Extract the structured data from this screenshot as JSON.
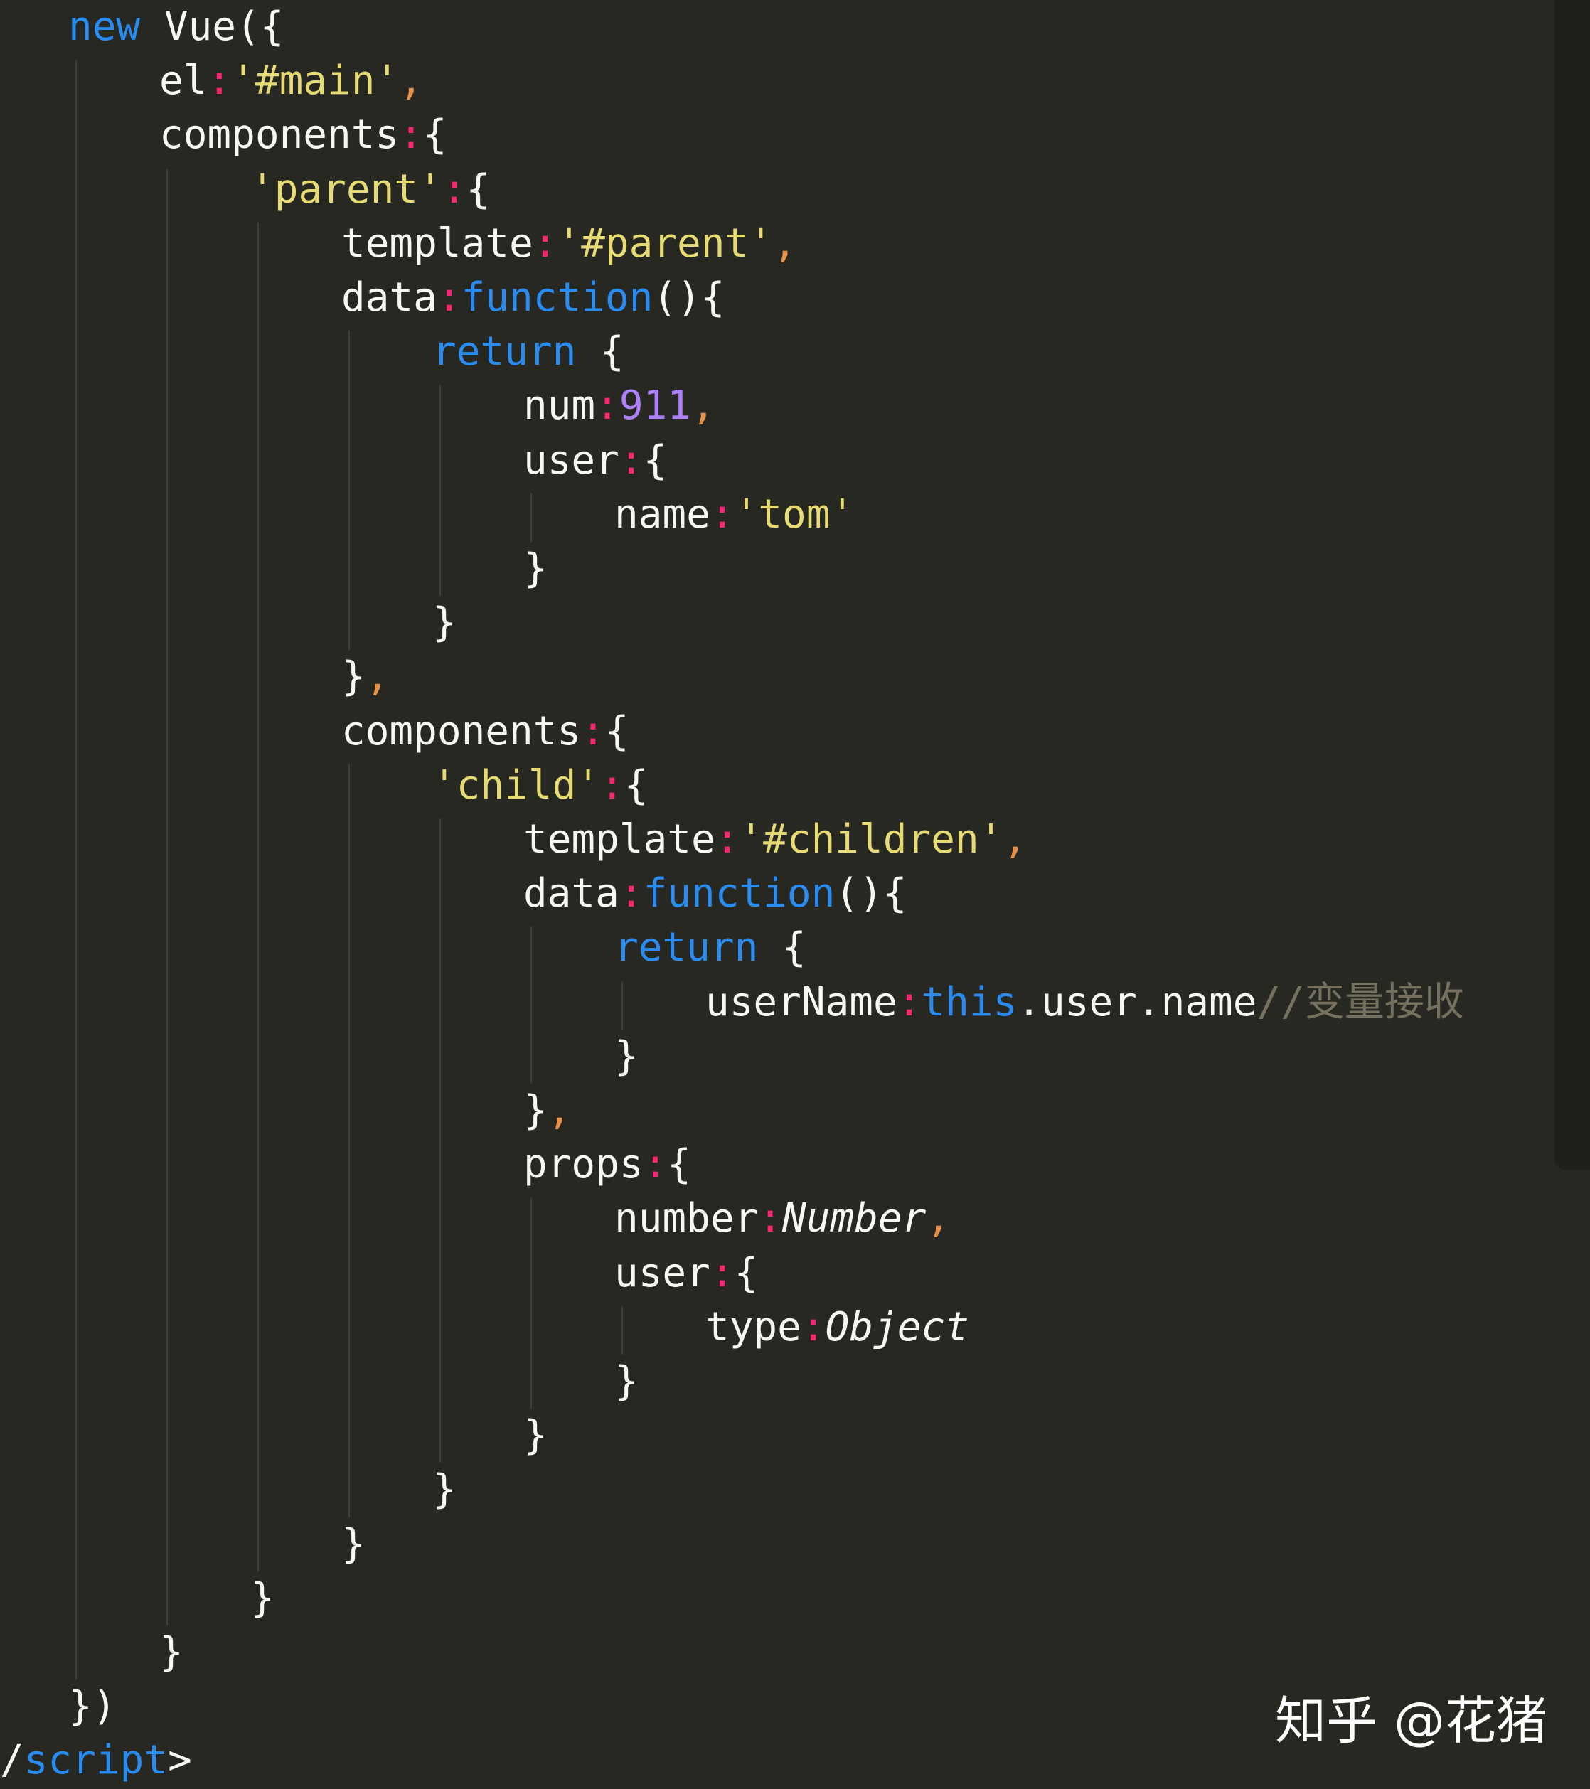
{
  "colors": {
    "background": "#272822",
    "keyword": "#2A8CF0",
    "string": "#E6DB74",
    "number": "#AE81FF",
    "colon": "#F92672",
    "comma": "#E6904A",
    "comment": "#75715E",
    "plain": "#F8F8F2"
  },
  "watermark": "知乎 @花猪",
  "code_lines": [
    {
      "indent": 1,
      "tokens": [
        {
          "t": "keyword",
          "v": "new"
        },
        {
          "t": "plain",
          "v": " Vue({"
        }
      ]
    },
    {
      "indent": 2,
      "tokens": [
        {
          "t": "plain",
          "v": "el"
        },
        {
          "t": "colon",
          "v": ":"
        },
        {
          "t": "string",
          "v": "'#main'"
        },
        {
          "t": "comma",
          "v": ","
        }
      ]
    },
    {
      "indent": 2,
      "tokens": [
        {
          "t": "plain",
          "v": "components"
        },
        {
          "t": "colon",
          "v": ":"
        },
        {
          "t": "plain",
          "v": "{"
        }
      ]
    },
    {
      "indent": 3,
      "tokens": [
        {
          "t": "string",
          "v": "'parent'"
        },
        {
          "t": "colon",
          "v": ":"
        },
        {
          "t": "plain",
          "v": "{"
        }
      ]
    },
    {
      "indent": 4,
      "tokens": [
        {
          "t": "plain",
          "v": "template"
        },
        {
          "t": "colon",
          "v": ":"
        },
        {
          "t": "string",
          "v": "'#parent'"
        },
        {
          "t": "comma",
          "v": ","
        }
      ]
    },
    {
      "indent": 4,
      "tokens": [
        {
          "t": "plain",
          "v": "data"
        },
        {
          "t": "colon",
          "v": ":"
        },
        {
          "t": "keyword",
          "v": "function"
        },
        {
          "t": "plain",
          "v": "(){"
        }
      ]
    },
    {
      "indent": 5,
      "tokens": [
        {
          "t": "keyword",
          "v": "return"
        },
        {
          "t": "plain",
          "v": " {"
        }
      ]
    },
    {
      "indent": 6,
      "tokens": [
        {
          "t": "plain",
          "v": "num"
        },
        {
          "t": "colon",
          "v": ":"
        },
        {
          "t": "number",
          "v": "911"
        },
        {
          "t": "comma",
          "v": ","
        }
      ]
    },
    {
      "indent": 6,
      "tokens": [
        {
          "t": "plain",
          "v": "user"
        },
        {
          "t": "colon",
          "v": ":"
        },
        {
          "t": "plain",
          "v": "{"
        }
      ]
    },
    {
      "indent": 7,
      "tokens": [
        {
          "t": "plain",
          "v": "name"
        },
        {
          "t": "colon",
          "v": ":"
        },
        {
          "t": "string",
          "v": "'tom'"
        }
      ]
    },
    {
      "indent": 6,
      "tokens": [
        {
          "t": "plain",
          "v": "}"
        }
      ]
    },
    {
      "indent": 5,
      "tokens": [
        {
          "t": "plain",
          "v": "}"
        }
      ]
    },
    {
      "indent": 4,
      "tokens": [
        {
          "t": "plain",
          "v": "}"
        },
        {
          "t": "comma",
          "v": ","
        }
      ]
    },
    {
      "indent": 4,
      "tokens": [
        {
          "t": "plain",
          "v": "components"
        },
        {
          "t": "colon",
          "v": ":"
        },
        {
          "t": "plain",
          "v": "{"
        }
      ]
    },
    {
      "indent": 5,
      "tokens": [
        {
          "t": "string",
          "v": "'child'"
        },
        {
          "t": "colon",
          "v": ":"
        },
        {
          "t": "plain",
          "v": "{"
        }
      ]
    },
    {
      "indent": 6,
      "tokens": [
        {
          "t": "plain",
          "v": "template"
        },
        {
          "t": "colon",
          "v": ":"
        },
        {
          "t": "string",
          "v": "'#children'"
        },
        {
          "t": "comma",
          "v": ","
        }
      ]
    },
    {
      "indent": 6,
      "tokens": [
        {
          "t": "plain",
          "v": "data"
        },
        {
          "t": "colon",
          "v": ":"
        },
        {
          "t": "keyword",
          "v": "function"
        },
        {
          "t": "plain",
          "v": "(){"
        }
      ]
    },
    {
      "indent": 7,
      "tokens": [
        {
          "t": "keyword",
          "v": "return"
        },
        {
          "t": "plain",
          "v": " {"
        }
      ]
    },
    {
      "indent": 8,
      "tokens": [
        {
          "t": "plain",
          "v": "userName"
        },
        {
          "t": "colon",
          "v": ":"
        },
        {
          "t": "keyword",
          "v": "this"
        },
        {
          "t": "plain",
          "v": ".user.name"
        },
        {
          "t": "comment",
          "v": "//变量接收"
        }
      ]
    },
    {
      "indent": 7,
      "tokens": [
        {
          "t": "plain",
          "v": "}"
        }
      ]
    },
    {
      "indent": 6,
      "tokens": [
        {
          "t": "plain",
          "v": "}"
        },
        {
          "t": "comma",
          "v": ","
        }
      ]
    },
    {
      "indent": 6,
      "tokens": [
        {
          "t": "plain",
          "v": "props"
        },
        {
          "t": "colon",
          "v": ":"
        },
        {
          "t": "plain",
          "v": "{"
        }
      ]
    },
    {
      "indent": 7,
      "tokens": [
        {
          "t": "plain",
          "v": "number"
        },
        {
          "t": "colon",
          "v": ":"
        },
        {
          "t": "type",
          "v": "Number"
        },
        {
          "t": "comma",
          "v": ","
        }
      ]
    },
    {
      "indent": 7,
      "tokens": [
        {
          "t": "plain",
          "v": "user"
        },
        {
          "t": "colon",
          "v": ":"
        },
        {
          "t": "plain",
          "v": "{"
        }
      ]
    },
    {
      "indent": 8,
      "tokens": [
        {
          "t": "plain",
          "v": "type"
        },
        {
          "t": "colon",
          "v": ":"
        },
        {
          "t": "type",
          "v": "Object"
        }
      ]
    },
    {
      "indent": 7,
      "tokens": [
        {
          "t": "plain",
          "v": "}"
        }
      ]
    },
    {
      "indent": 6,
      "tokens": [
        {
          "t": "plain",
          "v": "}"
        }
      ]
    },
    {
      "indent": 5,
      "tokens": [
        {
          "t": "plain",
          "v": "}"
        }
      ]
    },
    {
      "indent": 4,
      "tokens": [
        {
          "t": "plain",
          "v": "}"
        }
      ]
    },
    {
      "indent": 3,
      "tokens": [
        {
          "t": "plain",
          "v": "}"
        }
      ]
    },
    {
      "indent": 2,
      "tokens": [
        {
          "t": "plain",
          "v": "}"
        }
      ]
    },
    {
      "indent": 1,
      "tokens": [
        {
          "t": "plain",
          "v": "})"
        }
      ]
    },
    {
      "indent": 0,
      "tokens": [
        {
          "t": "plain",
          "v": "/"
        },
        {
          "t": "tag",
          "v": "script"
        },
        {
          "t": "plain",
          "v": ">"
        }
      ]
    }
  ]
}
